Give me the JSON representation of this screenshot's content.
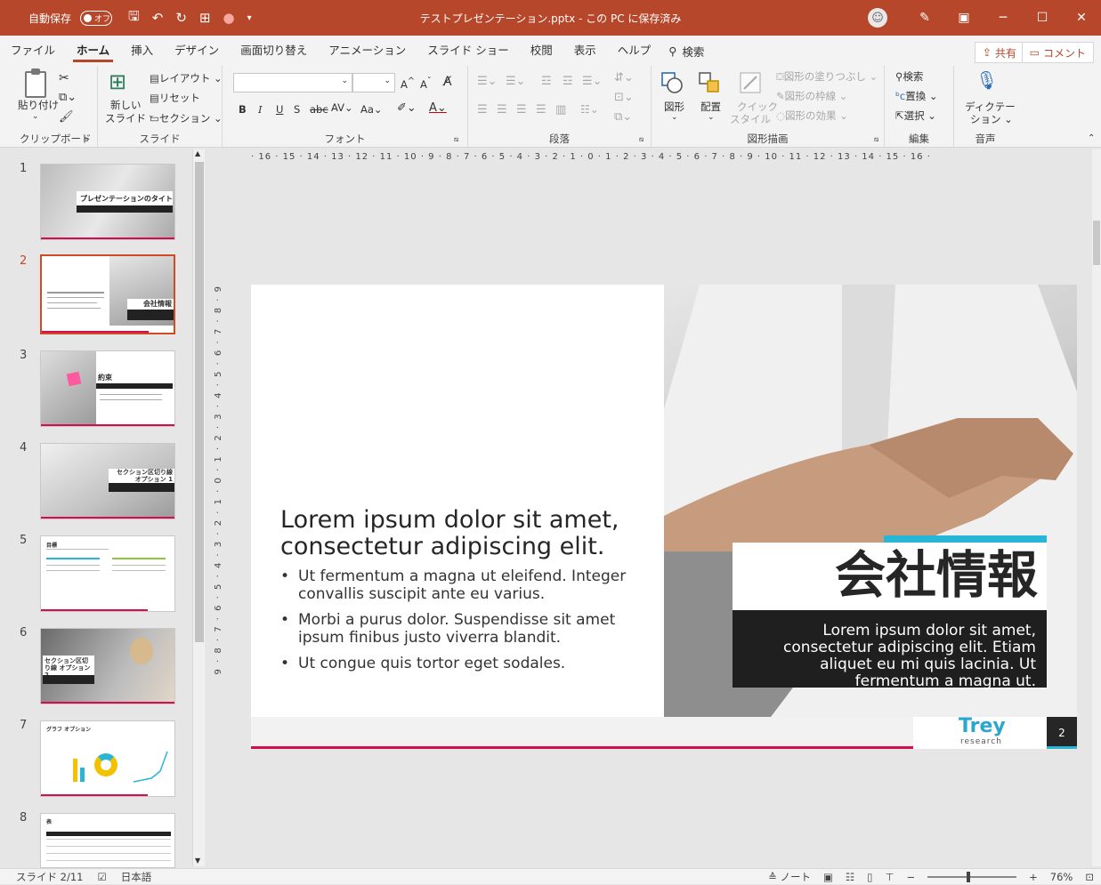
{
  "titlebar": {
    "autosave_label": "自動保存",
    "autosave_state": "オフ",
    "doc_title": "テストプレゼンテーション.pptx - この PC に保存済み"
  },
  "menu": {
    "tabs": [
      "ファイル",
      "ホーム",
      "挿入",
      "デザイン",
      "画面切り替え",
      "アニメーション",
      "スライド ショー",
      "校閲",
      "表示",
      "ヘルプ"
    ],
    "active": "ホーム",
    "search": "検索",
    "share": "共有",
    "comment": "コメント"
  },
  "ribbon": {
    "clipboard": {
      "paste": "貼り付け",
      "label": "クリップボード"
    },
    "slides": {
      "new_slide_1": "新しい",
      "new_slide_2": "スライド",
      "layout": "レイアウト",
      "reset": "リセット",
      "section": "セクション",
      "label": "スライド"
    },
    "font": {
      "label": "フォント",
      "bold": "B",
      "italic": "I",
      "underline": "U",
      "shadow": "S",
      "strike": "abc",
      "aa": "Aa"
    },
    "paragraph": {
      "label": "段落"
    },
    "drawing": {
      "shapes": "図形",
      "arrange": "配置",
      "quick_styles_1": "クイック",
      "quick_styles_2": "スタイル",
      "fill": "図形の塗りつぶし",
      "outline": "図形の枠線",
      "effects": "図形の効果",
      "label": "図形描画"
    },
    "editing": {
      "find": "検索",
      "replace": "置換",
      "select": "選択",
      "label": "編集"
    },
    "voice": {
      "dictate_1": "ディクテー",
      "dictate_2": "ション",
      "label": "音声"
    }
  },
  "ruler": {
    "horizontal": "· 16 · 15 · 14 · 13 · 12 · 11 · 10 · 9 · 8 · 7 · 6 · 5 · 4 · 3 · 2 · 1 · 0 · 1 · 2 · 3 · 4 · 5 · 6 · 7 · 8 · 9 · 10 · 11 · 12 · 13 · 14 · 15 · 16 ·",
    "vertical": "9 · 8 · 7 · 6 · 5 · 4 · 3 · 2 · 1 · 0 · 1 · 2 · 3 · 4 · 5 · 6 · 7 · 8 · 9"
  },
  "thumbnails": [
    {
      "num": "1",
      "title": "プレゼンテーションのタイトル"
    },
    {
      "num": "2",
      "title": "会社情報"
    },
    {
      "num": "3",
      "title": "約束"
    },
    {
      "num": "4",
      "title": "セクション区切り線 オプション 1"
    },
    {
      "num": "5",
      "title": "目標"
    },
    {
      "num": "6",
      "title": "セクション区切り線 オプション 2"
    },
    {
      "num": "7",
      "title": "グラフ オプション"
    },
    {
      "num": "8",
      "title": "表"
    }
  ],
  "slide": {
    "title": "Lorem ipsum dolor sit amet, consectetur adipiscing elit.",
    "bullets": [
      "Ut fermentum a magna ut eleifend. Integer convallis suscipit ante eu varius.",
      "Morbi a purus dolor. Suspendisse sit amet ipsum finibus justo viverra blandit.",
      "Ut congue quis tortor eget sodales."
    ],
    "company_title": "会社情報",
    "company_desc": "Lorem ipsum dolor sit amet, consectetur adipiscing elit. Etiam aliquet eu mi quis lacinia. Ut fermentum a magna ut.",
    "logo_main": "Trey",
    "logo_sub": "research",
    "page_number": "2"
  },
  "status": {
    "slide_info": "スライド 2/11",
    "language": "日本語",
    "notes": "ノート",
    "zoom": "76%"
  },
  "colors": {
    "titlebar": "#b7472a",
    "accent_cyan": "#29b6d6",
    "accent_red": "#d40d4d"
  }
}
